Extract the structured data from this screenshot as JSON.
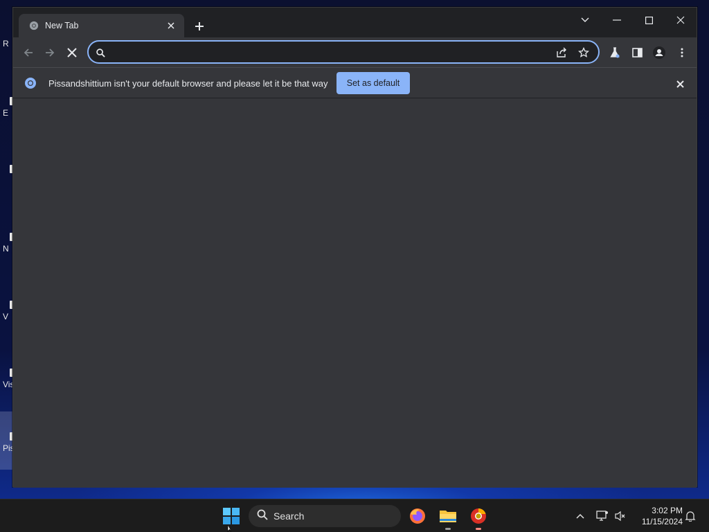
{
  "desktop": {
    "icons": [
      {
        "label": "R"
      },
      {
        "label": "E"
      },
      {
        "label": ""
      },
      {
        "label": "N"
      },
      {
        "label": "V"
      },
      {
        "label": "Vis"
      },
      {
        "label": "Pis"
      }
    ]
  },
  "browser": {
    "tab": {
      "title": "New Tab"
    },
    "omnibox": {
      "value": "",
      "placeholder": ""
    },
    "infobar": {
      "message": "Pissandshittium isn't your default browser and please let it be that way",
      "button_label": "Set as default"
    },
    "colors": {
      "accent": "#8ab4f8",
      "frame": "#202124",
      "toolbar": "#35363a"
    }
  },
  "taskbar": {
    "search_label": "Search",
    "clock": {
      "time": "3:02 PM",
      "date": "11/15/2024"
    },
    "apps": [
      "firefox-icon",
      "file-explorer-icon",
      "pissandshittium-icon"
    ]
  }
}
